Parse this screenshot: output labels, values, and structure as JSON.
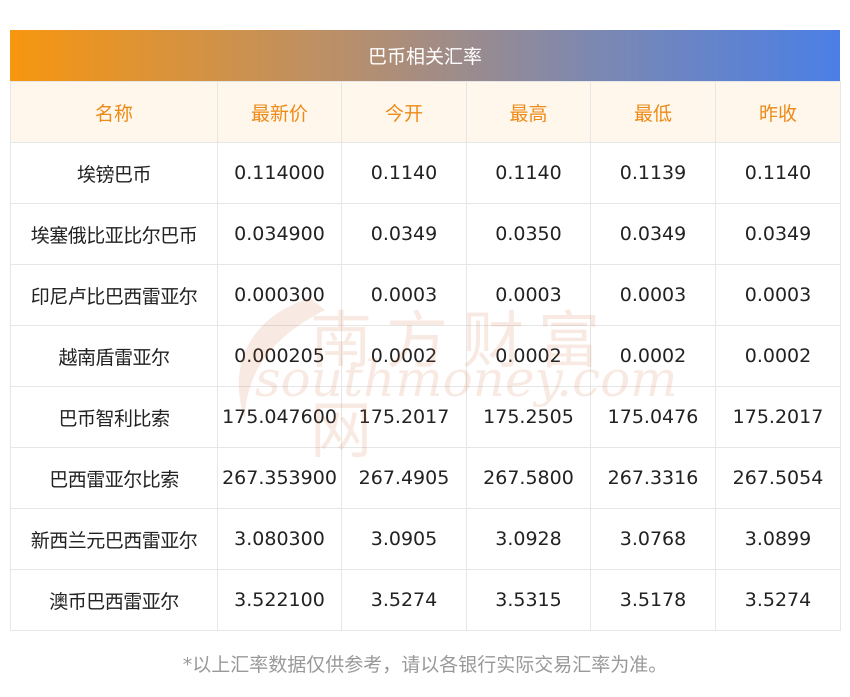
{
  "title": "巴币相关汇率",
  "columns": [
    "名称",
    "最新价",
    "今开",
    "最高",
    "最低",
    "昨收"
  ],
  "rows": [
    [
      "埃镑巴币",
      "0.114000",
      "0.1140",
      "0.1140",
      "0.1139",
      "0.1140"
    ],
    [
      "埃塞俄比亚比尔巴币",
      "0.034900",
      "0.0349",
      "0.0350",
      "0.0349",
      "0.0349"
    ],
    [
      "印尼卢比巴西雷亚尔",
      "0.000300",
      "0.0003",
      "0.0003",
      "0.0003",
      "0.0003"
    ],
    [
      "越南盾雷亚尔",
      "0.000205",
      "0.0002",
      "0.0002",
      "0.0002",
      "0.0002"
    ],
    [
      "巴币智利比索",
      "175.047600",
      "175.2017",
      "175.2505",
      "175.0476",
      "175.2017"
    ],
    [
      "巴西雷亚尔比索",
      "267.353900",
      "267.4905",
      "267.5800",
      "267.3316",
      "267.5054"
    ],
    [
      "新西兰元巴西雷亚尔",
      "3.080300",
      "3.0905",
      "3.0928",
      "3.0768",
      "3.0899"
    ],
    [
      "澳币巴西雷亚尔",
      "3.522100",
      "3.5274",
      "3.5315",
      "3.5178",
      "3.5274"
    ]
  ],
  "watermark": {
    "cn": "南方财富网",
    "en": "southmoney.com"
  },
  "footnote": "*以上汇率数据仅供参考，请以各银行实际交易汇率为准。",
  "colors": {
    "banner_start": "#f7960f",
    "banner_end": "#4b7fe6",
    "header_text": "#ee8a17",
    "header_bg": "#fff7eb"
  }
}
